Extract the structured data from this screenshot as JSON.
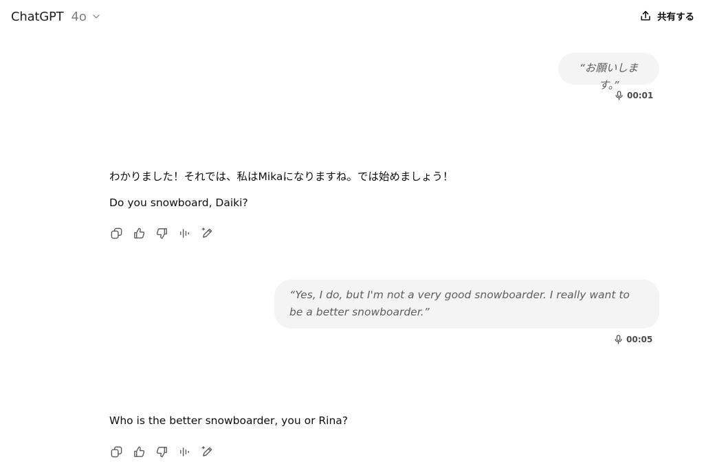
{
  "header": {
    "model_name": "ChatGPT",
    "model_version": "4o",
    "share_label": "共有する"
  },
  "messages": [
    {
      "role": "user",
      "text": "“お願いします。”",
      "duration": "00:01"
    },
    {
      "role": "assistant",
      "lines": [
        "わかりました！それでは、私はMikaになりますね。では始めましょう！",
        "Do you snowboard, Daiki?"
      ]
    },
    {
      "role": "user",
      "text": "“Yes, I do, but I'm not a very good snowboarder. I really want to be a better snowboarder.”",
      "duration": "00:05"
    },
    {
      "role": "assistant",
      "lines": [
        "Who is the better snowboarder, you or Rina?"
      ]
    }
  ],
  "icons": {
    "model_chevron": "chevron-down-icon",
    "share": "share-upload-icon",
    "voice": "microphone-icon",
    "actions": [
      "copy-icon",
      "thumbs-up-icon",
      "thumbs-down-icon",
      "read-aloud-icon",
      "edit-sparkle-icon"
    ]
  }
}
